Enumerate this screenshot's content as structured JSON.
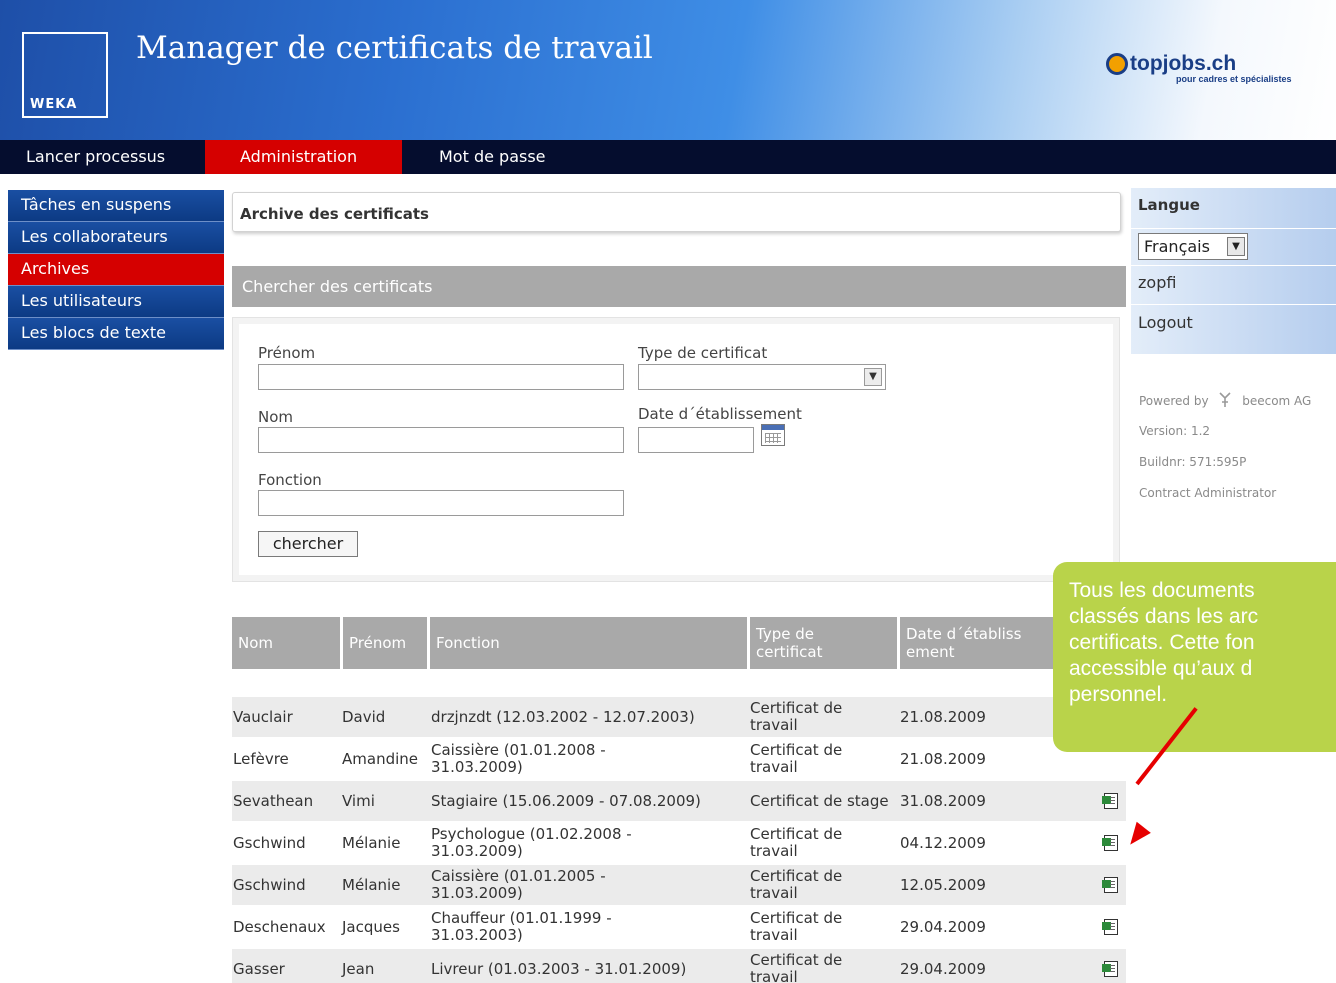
{
  "header": {
    "brand_logo": "WEKA",
    "app_title": "Manager de certificats de travail",
    "partner_logo": "topjobs.ch",
    "partner_tagline": "pour cadres et spécialistes"
  },
  "topnav": [
    {
      "label": "Lancer processus"
    },
    {
      "label": "Administration"
    },
    {
      "label": "Mot de passe"
    }
  ],
  "sidebar": [
    {
      "label": "Tâches en suspens"
    },
    {
      "label": "Les collaborateurs"
    },
    {
      "label": "Archives"
    },
    {
      "label": "Les utilisateurs"
    },
    {
      "label": "Les blocs de texte"
    }
  ],
  "page": {
    "title": "Archive des certificats",
    "search_header": "Chercher des certificats"
  },
  "form": {
    "firstname_label": "Prénom",
    "firstname_value": "",
    "lastname_label": "Nom",
    "lastname_value": "",
    "function_label": "Fonction",
    "function_value": "",
    "type_label": "Type de certificat",
    "type_value": "",
    "date_label": "Date d´établissement",
    "date_value": "",
    "search_button": "chercher"
  },
  "table": {
    "headers": [
      "Nom",
      "Prénom",
      "Fonction",
      "Type de certificat",
      "Date d´établissement"
    ],
    "rows": [
      {
        "nom": "Vauclair",
        "prenom": "David",
        "fonction": "drzjnzdt (12.03.2002 - 12.07.2003)",
        "type": "Certificat de travail",
        "date": "21.08.2009"
      },
      {
        "nom": "Lefèvre",
        "prenom": "Amandine",
        "fonction": "Caissière (01.01.2008 - 31.03.2009)",
        "type": "Certificat de travail",
        "date": "21.08.2009"
      },
      {
        "nom": "Sevathean",
        "prenom": "Vimi",
        "fonction": "Stagiaire (15.06.2009 - 07.08.2009)",
        "type": "Certificat de stage",
        "date": "31.08.2009"
      },
      {
        "nom": "Gschwind",
        "prenom": "Mélanie",
        "fonction": "Psychologue (01.02.2008 - 31.03.2009)",
        "type": "Certificat de travail",
        "date": "04.12.2009"
      },
      {
        "nom": "Gschwind",
        "prenom": "Mélanie",
        "fonction": "Caissière (01.01.2005 - 31.03.2009)",
        "type": "Certificat de travail",
        "date": "12.05.2009"
      },
      {
        "nom": "Deschenaux",
        "prenom": "Jacques",
        "fonction": "Chauffeur (01.01.1999 - 31.03.2003)",
        "type": "Certificat de travail",
        "date": "29.04.2009"
      },
      {
        "nom": "Gasser",
        "prenom": "Jean",
        "fonction": "Livreur (01.03.2003 - 31.01.2009)",
        "type": "Certificat de travail",
        "date": "29.04.2009"
      }
    ],
    "row_icon": "document-icon"
  },
  "right_panel": {
    "language_title": "Langue",
    "language_value": "Français",
    "username": "zopfi",
    "logout": "Logout",
    "powered_by": "Powered by",
    "powered_company": "beecom AG",
    "version": "Version: 1.2",
    "build": "Buildnr: 571:595P",
    "role": "Contract Administrator"
  },
  "callout": {
    "line1": "Tous les documents",
    "line2": "classés dans les arc",
    "line3": "certificats. Cette fon",
    "line4": "accessible qu’aux d",
    "line5": "personnel."
  },
  "colors": {
    "nav_bg": "#050d2e",
    "active_red": "#d50000",
    "sidebar_blue": "#1a4fa3",
    "callout_green": "#b9d34a",
    "arrow_red": "#e60000"
  }
}
